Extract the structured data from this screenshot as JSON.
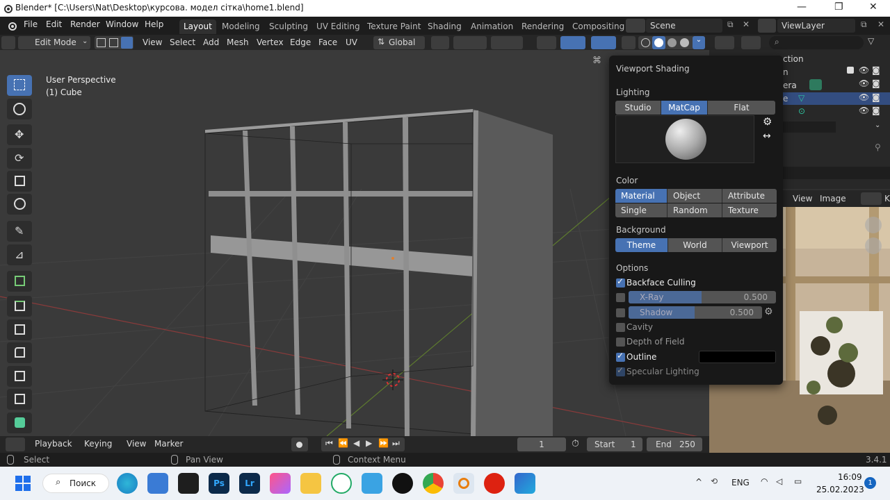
{
  "window": {
    "title": "Blender* [C:\\Users\\Nat\\Desktop\\курсова. модел сітка\\home1.blend]"
  },
  "menu": [
    "File",
    "Edit",
    "Render",
    "Window",
    "Help"
  ],
  "workspaces": [
    "Layout",
    "Modeling",
    "Sculpting",
    "UV Editing",
    "Texture Paint",
    "Shading",
    "Animation",
    "Rendering",
    "Compositing"
  ],
  "scene": "Scene",
  "view_layer": "ViewLayer",
  "header": {
    "mode": "Edit Mode",
    "menus": [
      "View",
      "Select",
      "Add",
      "Mesh",
      "Vertex",
      "Edge",
      "Face",
      "UV"
    ],
    "orientation": "Global"
  },
  "viewport": {
    "perspective": "User Perspective",
    "object": "(1) Cube"
  },
  "outliner": {
    "partial": [
      "ction",
      "n",
      "era",
      "e"
    ]
  },
  "image_editor": {
    "menus": [
      "View",
      "Image"
    ],
    "partial": "K"
  },
  "shading_popup": {
    "title": "Viewport Shading",
    "lighting_label": "Lighting",
    "lighting": [
      "Studio",
      "MatCap",
      "Flat"
    ],
    "lighting_active": "MatCap",
    "color_label": "Color",
    "color": [
      "Material",
      "Object",
      "Attribute",
      "Single",
      "Random",
      "Texture"
    ],
    "color_active": "Material",
    "background_label": "Background",
    "background": [
      "Theme",
      "World",
      "Viewport"
    ],
    "background_active": "Theme",
    "options_label": "Options",
    "backface_culling": {
      "label": "Backface Culling",
      "checked": true
    },
    "xray": {
      "label": "X-Ray",
      "value": "0.500",
      "checked": false
    },
    "shadow": {
      "label": "Shadow",
      "value": "0.500",
      "checked": false
    },
    "cavity": {
      "label": "Cavity",
      "checked": false
    },
    "dof": {
      "label": "Depth of Field",
      "checked": false
    },
    "outline": {
      "label": "Outline",
      "checked": true,
      "color": "#000000"
    },
    "specular": {
      "label": "Specular Lighting",
      "checked": true
    }
  },
  "timeline": {
    "menus": [
      "Playback",
      "Keying",
      "View",
      "Marker"
    ],
    "current_frame": "1",
    "start_label": "Start",
    "start": "1",
    "end_label": "End",
    "end": "250"
  },
  "status": {
    "select": "Select",
    "pan": "Pan View",
    "context": "Context Menu",
    "version": "3.4.1"
  },
  "taskbar": {
    "search": "Поиск",
    "lang": "ENG",
    "time": "16:09",
    "date": "25.02.2023",
    "notif": "1"
  },
  "colors": {
    "accent": "#4772b3",
    "bg": "#303030",
    "header": "#262626"
  }
}
